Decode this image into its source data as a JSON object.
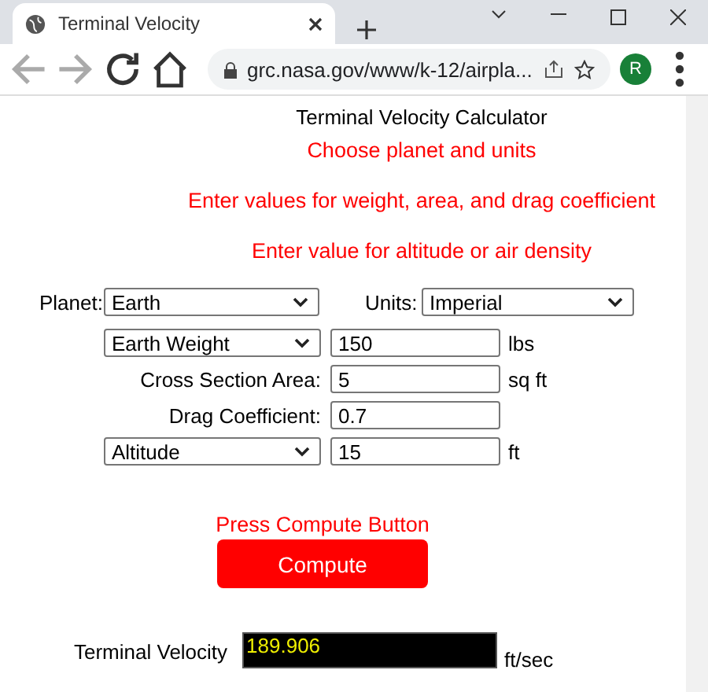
{
  "browser": {
    "tab_title": "Terminal Velocity",
    "address": "grc.nasa.gov/www/k-12/airpla...",
    "profile_initial": "R"
  },
  "page": {
    "title": "Terminal Velocity Calculator",
    "instructions": [
      "Choose planet and units",
      "Enter values for weight, area, and drag coefficient",
      "Enter value for altitude or air density"
    ],
    "planet": {
      "label": "Planet:",
      "value": "Earth"
    },
    "units": {
      "label": "Units:",
      "value": "Imperial"
    },
    "rows": [
      {
        "kind": "select",
        "selector": "Earth Weight",
        "value": "150",
        "unit": "lbs"
      },
      {
        "kind": "label",
        "label": "Cross Section Area:",
        "value": "5",
        "unit": "sq ft"
      },
      {
        "kind": "label",
        "label": "Drag Coefficient:",
        "value": "0.7"
      },
      {
        "kind": "select",
        "selector": "Altitude",
        "value": "15",
        "unit": "ft"
      }
    ],
    "compute_prompt": "Press Compute Button",
    "compute_button": "Compute",
    "result": {
      "label": "Terminal Velocity",
      "value": "189.906",
      "unit": "ft/sec"
    }
  }
}
